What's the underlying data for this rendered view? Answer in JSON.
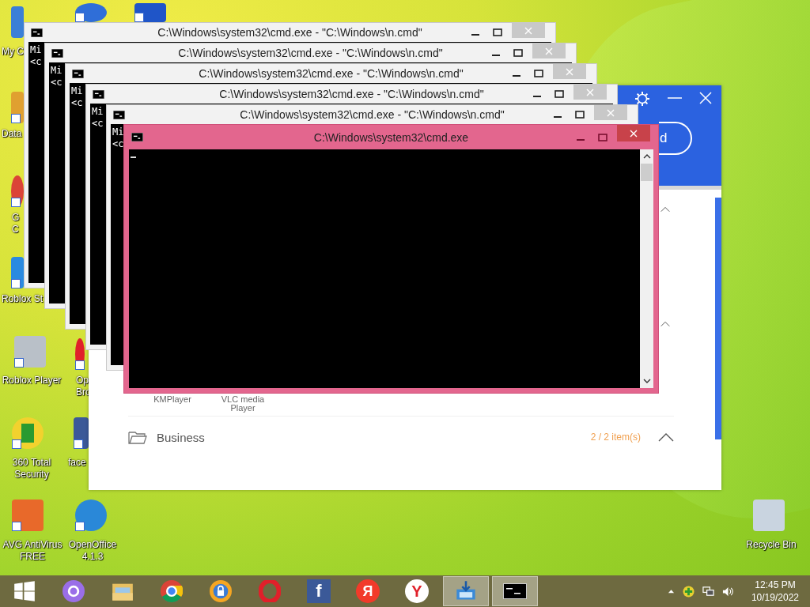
{
  "desktop_icons": [
    {
      "kind": "computer",
      "lines": [
        "My C"
      ]
    },
    {
      "kind": "database",
      "lines": [
        "Data"
      ]
    },
    {
      "kind": "chrome",
      "lines": [
        "G",
        "C"
      ]
    },
    {
      "kind": "studio",
      "lines": [
        "Roblox St"
      ]
    },
    {
      "kind": "roblox",
      "lines": [
        "Roblox Player"
      ]
    },
    {
      "kind": "plus",
      "lines": [
        "360 Total",
        "Security"
      ]
    },
    {
      "kind": "avg",
      "lines": [
        "AVG AntiVirus",
        "FREE"
      ]
    },
    {
      "kind": "cd"
    },
    {
      "kind": "blue"
    },
    {
      "kind": "opera",
      "lines": [
        "Op",
        "Bro"
      ]
    },
    {
      "kind": "facebook",
      "lines": [
        "face"
      ]
    },
    {
      "kind": "openoffice",
      "lines": [
        "OpenOffice",
        "4.1.3"
      ]
    },
    {
      "kind": "bin",
      "lines": [
        "Recycle Bin"
      ]
    }
  ],
  "app_window": {
    "button_text": "d",
    "apps": [
      {
        "label": "KMPlayer"
      },
      {
        "label": "VLC media",
        "label2": "Player"
      }
    ],
    "category": {
      "name": "Business",
      "count": "2 / 2 item(s)",
      "expanded": true
    }
  },
  "console_windows": [
    {
      "title": "C:\\Windows\\system32\\cmd.exe - \"C:\\Windows\\n.cmd\"",
      "lines": [
        "Mi",
        "<c"
      ],
      "active": false
    },
    {
      "title": "C:\\Windows\\system32\\cmd.exe - \"C:\\Windows\\n.cmd\"",
      "lines": [
        "Mi",
        "<c"
      ],
      "active": false
    },
    {
      "title": "C:\\Windows\\system32\\cmd.exe - \"C:\\Windows\\n.cmd\"",
      "lines": [
        "Mi",
        "<c"
      ],
      "active": false
    },
    {
      "title": "C:\\Windows\\system32\\cmd.exe - \"C:\\Windows\\n.cmd\"",
      "lines": [
        "Mi",
        "<c"
      ],
      "active": false
    },
    {
      "title": "C:\\Windows\\system32\\cmd.exe - \"C:\\Windows\\n.cmd\"",
      "lines": [
        "Mi",
        "<c"
      ],
      "active": false
    },
    {
      "title": "C:\\Windows\\system32\\cmd.exe",
      "active": true
    }
  ],
  "taskbar": {
    "items": [
      {
        "kind": "start",
        "selected": false
      },
      {
        "kind": "assistant",
        "selected": false
      },
      {
        "kind": "folder",
        "selected": false
      },
      {
        "kind": "chrome",
        "selected": false
      },
      {
        "kind": "shield-browser",
        "selected": false
      },
      {
        "kind": "opera",
        "selected": false
      },
      {
        "kind": "glyph-square",
        "glyph": "f",
        "selected": false
      },
      {
        "kind": "glyph-red",
        "glyph": "Я",
        "selected": false
      },
      {
        "kind": "glyph-white",
        "glyph": "Y",
        "selected": false
      },
      {
        "kind": "installer",
        "selected": true
      },
      {
        "kind": "console",
        "selected": true
      }
    ],
    "time": "12:45 PM",
    "date": "10/19/2022"
  }
}
